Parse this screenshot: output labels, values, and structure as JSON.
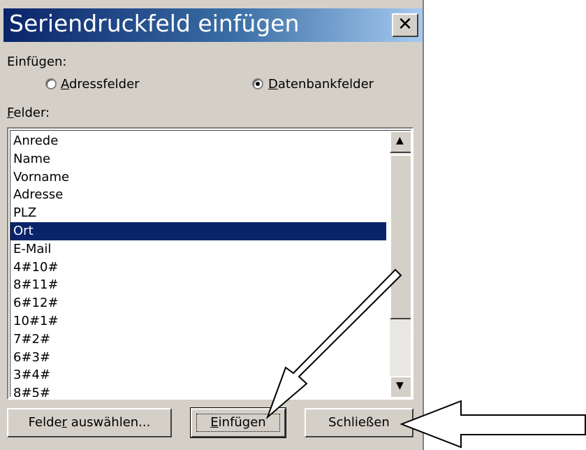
{
  "dialog": {
    "title": "Seriendruckfeld einfügen",
    "close_glyph": "✕",
    "insert_label": "Einfügen:",
    "radio_address": {
      "first": "A",
      "rest": "dressfelder",
      "selected": false
    },
    "radio_database": {
      "first": "D",
      "rest": "atenbankfelder",
      "selected": true
    },
    "fields_label": {
      "first": "F",
      "rest": "elder:"
    },
    "fields": [
      "Anrede",
      "Name",
      "Vorname",
      "Adresse",
      "PLZ",
      "Ort",
      "E-Mail",
      "4#10#",
      "8#11#",
      "6#12#",
      "10#1#",
      "7#2#",
      "6#3#",
      "3#4#",
      "8#5#"
    ],
    "selected_field": "Ort",
    "buttons": {
      "select_fields": {
        "before": "Felde",
        "mnemonic": "r",
        "after": " auswählen..."
      },
      "insert": {
        "before": "",
        "mnemonic": "E",
        "after": "infügen"
      },
      "close": "Schließen"
    },
    "scroll_up_icon": "▲",
    "scroll_down_icon": "▼"
  },
  "colors": {
    "dialog_bg": "#d4d0c8",
    "title_start": "#0a246a",
    "title_end": "#a6caf0",
    "selection": "#0a246a"
  }
}
